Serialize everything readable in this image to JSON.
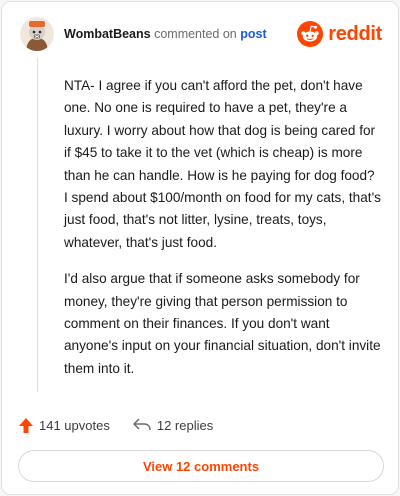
{
  "header": {
    "username": "WombatBeans",
    "action_text": "commented on",
    "post_link": "post",
    "brand": "reddit"
  },
  "comment": {
    "paragraphs": [
      "NTA- I agree if you can't afford the pet, don't have one. No one is required to have a pet, they're a luxury. I worry about how that dog is being cared for if $45 to take it to the vet (which is cheap) is more than he can handle. How is he paying for dog food? I spend about $100/month on food for my cats, that's just food, that's not litter, lysine, treats, toys, whatever, that's just food.",
      "I'd also argue that if someone asks somebody for money, they're giving that person permission to comment on their finances. If you don't want anyone's input on your financial situation, don't invite them into it."
    ]
  },
  "actions": {
    "upvotes": "141 upvotes",
    "replies": "12 replies"
  },
  "view_comments": "View 12 comments",
  "colors": {
    "accent": "#ff4500",
    "link": "#1a5bd6"
  },
  "icons": [
    "avatar",
    "reddit-logo-icon",
    "upvote-arrow-icon",
    "reply-arrow-icon"
  ]
}
